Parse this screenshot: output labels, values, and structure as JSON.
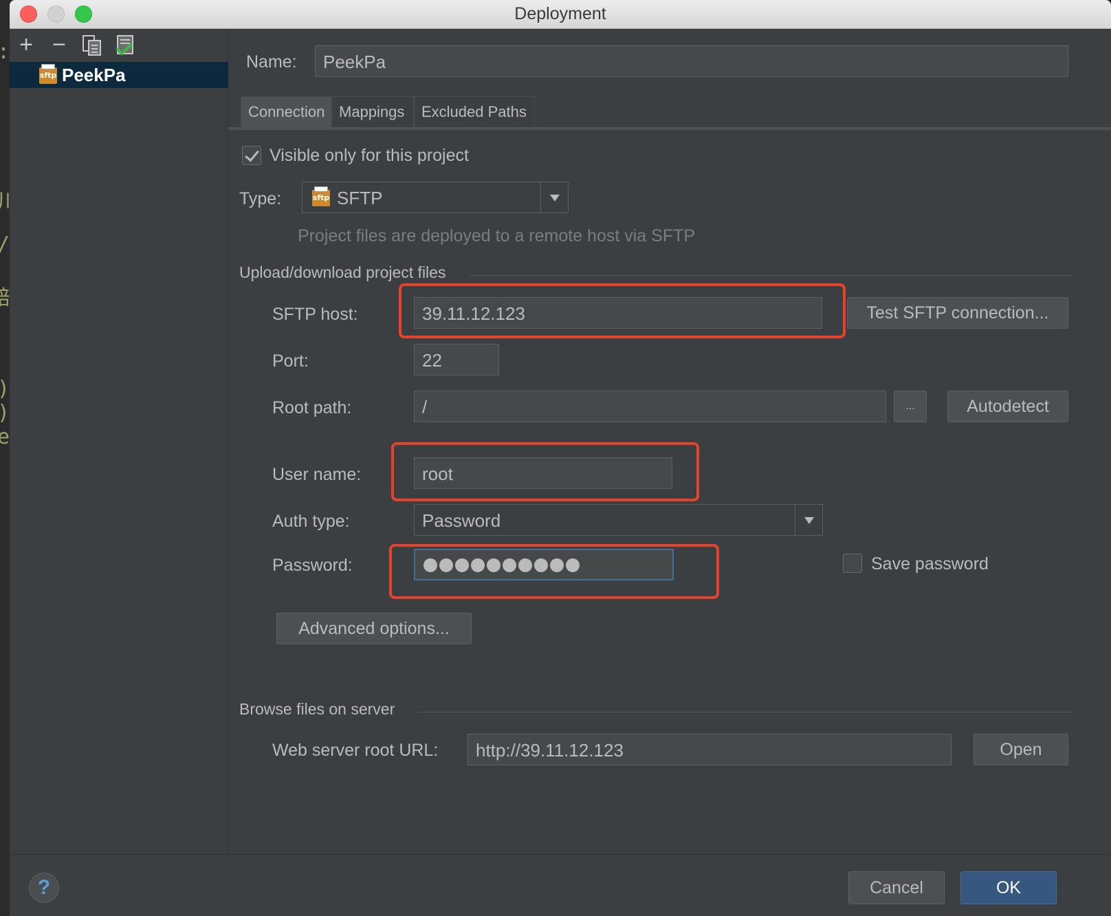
{
  "window": {
    "title": "Deployment"
  },
  "toolbar": {
    "add": "+",
    "remove": "−"
  },
  "servers": [
    {
      "icon_text": "sftp",
      "name": "PeekPa"
    }
  ],
  "form": {
    "name_label": "Name:",
    "name_value": "PeekPa",
    "tabs": [
      "Connection",
      "Mappings",
      "Excluded Paths"
    ],
    "active_tab": "Connection",
    "visible_only_label": "Visible only for this project",
    "visible_only_checked": true,
    "type_label": "Type:",
    "type_icon_text": "sftp",
    "type_value": "SFTP",
    "type_hint": "Project files are deployed to a remote host via SFTP",
    "upload_section": "Upload/download project files",
    "host_label": "SFTP host:",
    "host_value": "39.11.12.123",
    "test_button": "Test SFTP connection...",
    "port_label": "Port:",
    "port_value": "22",
    "root_label": "Root path:",
    "root_value": "/",
    "browse_button": "...",
    "autodetect_button": "Autodetect",
    "user_label": "User name:",
    "user_value": "root",
    "auth_label": "Auth type:",
    "auth_value": "Password",
    "password_label": "Password:",
    "password_mask_count": 10,
    "save_password_label": "Save password",
    "save_password_checked": false,
    "advanced_button": "Advanced options...",
    "browse_section": "Browse files on server",
    "web_url_label": "Web server root URL:",
    "web_url_value": "http://39.11.12.123",
    "open_button": "Open"
  },
  "footer": {
    "help": "?",
    "cancel": "Cancel",
    "ok": "OK"
  },
  "colors": {
    "highlight": "#e8432a",
    "selection": "#0d293e",
    "primary_button": "#365880"
  }
}
